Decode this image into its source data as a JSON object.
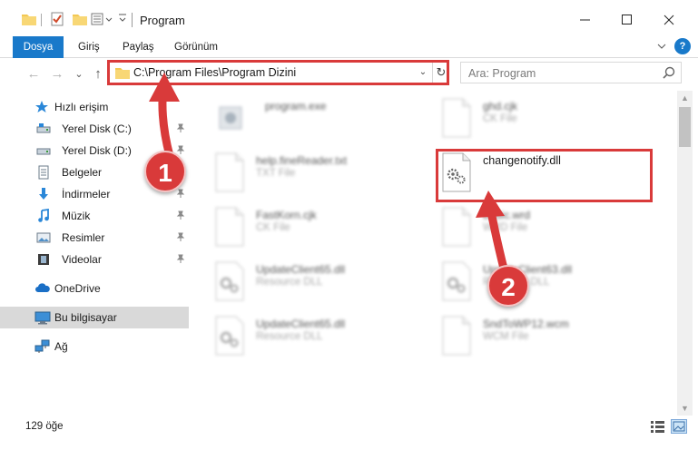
{
  "window": {
    "title": "Program",
    "minimize_glyph": "—",
    "maximize_glyph": "☐",
    "close_glyph": "✕"
  },
  "ribbon": {
    "tabs": [
      "Dosya",
      "Giriş",
      "Paylaş",
      "Görünüm"
    ],
    "help_glyph": "?",
    "accent_color": "#1979ca"
  },
  "nav": {
    "back_glyph": "←",
    "forward_glyph": "→",
    "recent_glyph": "⌄",
    "up_glyph": "↑",
    "address": "C:\\Program Files\\Program Dizini",
    "dropdown_glyph": "⌄",
    "refresh_glyph": "↻",
    "search_placeholder": "Ara: Program"
  },
  "sidebar": {
    "items": [
      {
        "label": "Hızlı erişim",
        "icon": "star-icon"
      },
      {
        "label": "Yerel Disk (C:)",
        "icon": "drive-icon",
        "pinned": true
      },
      {
        "label": "Yerel Disk (D:)",
        "icon": "drive-icon",
        "pinned": true
      },
      {
        "label": "Belgeler",
        "icon": "documents-icon",
        "pinned": true
      },
      {
        "label": "İndirmeler",
        "icon": "download-icon",
        "pinned": true
      },
      {
        "label": "Müzik",
        "icon": "music-icon",
        "pinned": true
      },
      {
        "label": "Resimler",
        "icon": "pictures-icon",
        "pinned": true
      },
      {
        "label": "Videolar",
        "icon": "videos-icon",
        "pinned": true
      },
      {
        "label": "OneDrive",
        "icon": "cloud-icon"
      },
      {
        "label": "Bu bilgisayar",
        "icon": "computer-icon",
        "selected": true
      },
      {
        "label": "Ağ",
        "icon": "network-icon"
      }
    ],
    "pin_glyph": "📌"
  },
  "files": [
    {
      "name": "program.exe",
      "type": "",
      "blurred": true
    },
    {
      "name": "ghd.cjk",
      "type": "CK File",
      "blurred": true
    },
    {
      "name": "help.fineReader.txt",
      "type": "TXT File",
      "blurred": true
    },
    {
      "name": "changenotify.dll",
      "type": "",
      "blurred": false
    },
    {
      "name": "FastKorn.cjk",
      "type": "CK File",
      "blurred": true
    },
    {
      "name": "Basic.wrd",
      "type": "WRD File",
      "blurred": true
    },
    {
      "name": "UpdateClient65.dll",
      "type": "Resource DLL",
      "blurred": true
    },
    {
      "name": "UpdateClient63.dll",
      "type": "Resource DLL",
      "blurred": true
    },
    {
      "name": "UpdateClient65.dll",
      "type": "Resource DLL",
      "blurred": true
    },
    {
      "name": "SndToWP12.wcm",
      "type": "WCM File",
      "blurred": true
    }
  ],
  "status": {
    "item_count": "129 öğe"
  },
  "annotations": {
    "marker_1": "1",
    "marker_2": "2",
    "highlight_color": "#d93a3a"
  }
}
